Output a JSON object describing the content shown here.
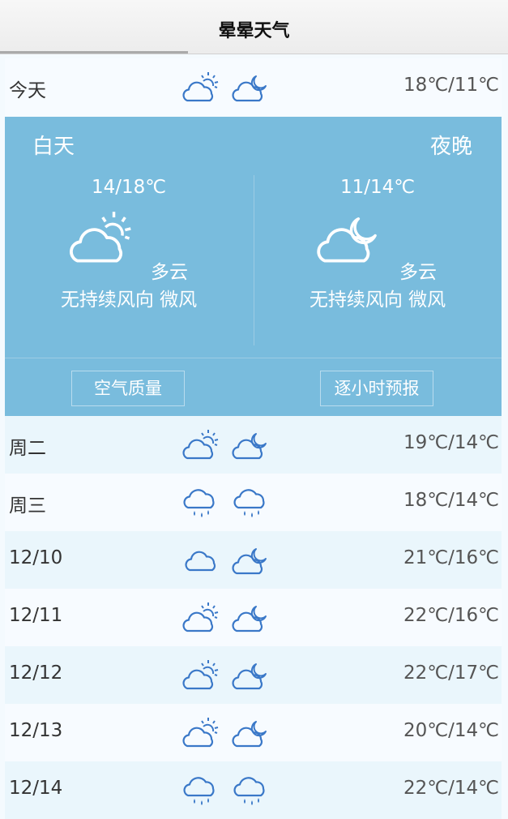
{
  "header": {
    "title": "晕晕天气"
  },
  "today": {
    "date": "今天",
    "temp": "18℃/11℃",
    "day_icon": "partly-cloudy-day-icon",
    "night_icon": "partly-cloudy-night-icon"
  },
  "detail": {
    "day_label": "白天",
    "night_label": "夜晚",
    "day": {
      "temp": "14/18℃",
      "condition": "多云",
      "wind": "无持续风向 微风",
      "icon": "partly-cloudy-day-icon"
    },
    "night": {
      "temp": "11/14℃",
      "condition": "多云",
      "wind": "无持续风向 微风",
      "icon": "partly-cloudy-night-icon"
    },
    "air_quality_label": "空气质量",
    "hourly_label": "逐小时预报"
  },
  "forecast": [
    {
      "date": "周二",
      "temp": "19℃/14℃",
      "day_icon": "partly-cloudy-day-icon",
      "night_icon": "partly-cloudy-night-icon"
    },
    {
      "date": "周三",
      "temp": "18℃/14℃",
      "day_icon": "rain-icon",
      "night_icon": "rain-icon"
    },
    {
      "date": "12/10",
      "temp": "21℃/16℃",
      "day_icon": "cloudy-icon",
      "night_icon": "partly-cloudy-night-icon"
    },
    {
      "date": "12/11",
      "temp": "22℃/16℃",
      "day_icon": "partly-cloudy-day-icon",
      "night_icon": "partly-cloudy-night-icon"
    },
    {
      "date": "12/12",
      "temp": "22℃/17℃",
      "day_icon": "partly-cloudy-day-icon",
      "night_icon": "partly-cloudy-night-icon"
    },
    {
      "date": "12/13",
      "temp": "20℃/14℃",
      "day_icon": "partly-cloudy-day-icon",
      "night_icon": "partly-cloudy-night-icon"
    },
    {
      "date": "12/14",
      "temp": "22℃/14℃",
      "day_icon": "rain-icon",
      "night_icon": "rain-icon"
    }
  ],
  "colors": {
    "panel": "#79bcdd",
    "icon": "#3a78c8",
    "row_alt": "#eaf6fc"
  }
}
